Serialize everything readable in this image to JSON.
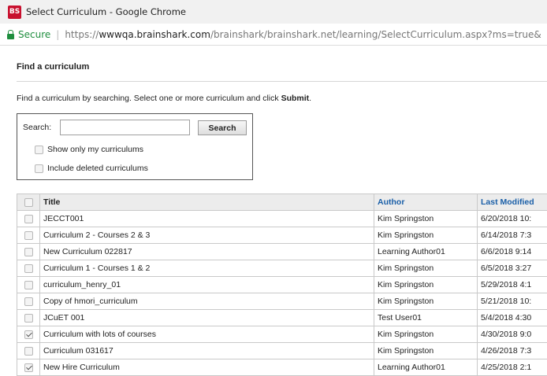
{
  "window": {
    "title": "Select Curriculum - Google Chrome",
    "logo_text": "BS"
  },
  "address": {
    "secure_label": "Secure",
    "separator": "|",
    "scheme": "https://",
    "host": "wwwqa.brainshark.com",
    "path": "/brainshark/brainshark.net/learning/SelectCurriculum.aspx?ms=true&"
  },
  "page": {
    "section_title": "Find a curriculum",
    "instructions_prefix": "Find a curriculum by searching. Select one or more curriculum and click ",
    "instructions_bold": "Submit",
    "instructions_suffix": "."
  },
  "search": {
    "label": "Search:",
    "value": "",
    "button_label": "Search",
    "option_mine": {
      "label": "Show only my curriculums",
      "checked": false
    },
    "option_deleted": {
      "label": "Include deleted curriculums",
      "checked": false
    }
  },
  "table": {
    "columns": {
      "title": "Title",
      "author": "Author",
      "last_modified": "Last Modified"
    },
    "rows": [
      {
        "checked": false,
        "title": "JECCT001",
        "author": "Kim Springston",
        "modified": "6/20/2018 10:"
      },
      {
        "checked": false,
        "title": "Curriculum 2 - Courses 2 & 3",
        "author": "Kim Springston",
        "modified": "6/14/2018 7:3"
      },
      {
        "checked": false,
        "title": "New Curriculum 022817",
        "author": "Learning Author01",
        "modified": "6/6/2018 9:14"
      },
      {
        "checked": false,
        "title": "Curriculum 1 - Courses 1 & 2",
        "author": "Kim Springston",
        "modified": "6/5/2018 3:27"
      },
      {
        "checked": false,
        "title": "curriculum_henry_01",
        "author": "Kim Springston",
        "modified": "5/29/2018 4:1"
      },
      {
        "checked": false,
        "title": "Copy of hmori_curriculum",
        "author": "Kim Springston",
        "modified": "5/21/2018 10:"
      },
      {
        "checked": false,
        "title": "JCuET 001",
        "author": "Test User01",
        "modified": "5/4/2018 4:30"
      },
      {
        "checked": true,
        "title": "Curriculum with lots of courses",
        "author": "Kim Springston",
        "modified": "4/30/2018 9:0"
      },
      {
        "checked": false,
        "title": "Curriculum 031617",
        "author": "Kim Springston",
        "modified": "4/26/2018 7:3"
      },
      {
        "checked": true,
        "title": "New Hire Curriculum",
        "author": "Learning Author01",
        "modified": "4/25/2018 2:1"
      }
    ]
  }
}
